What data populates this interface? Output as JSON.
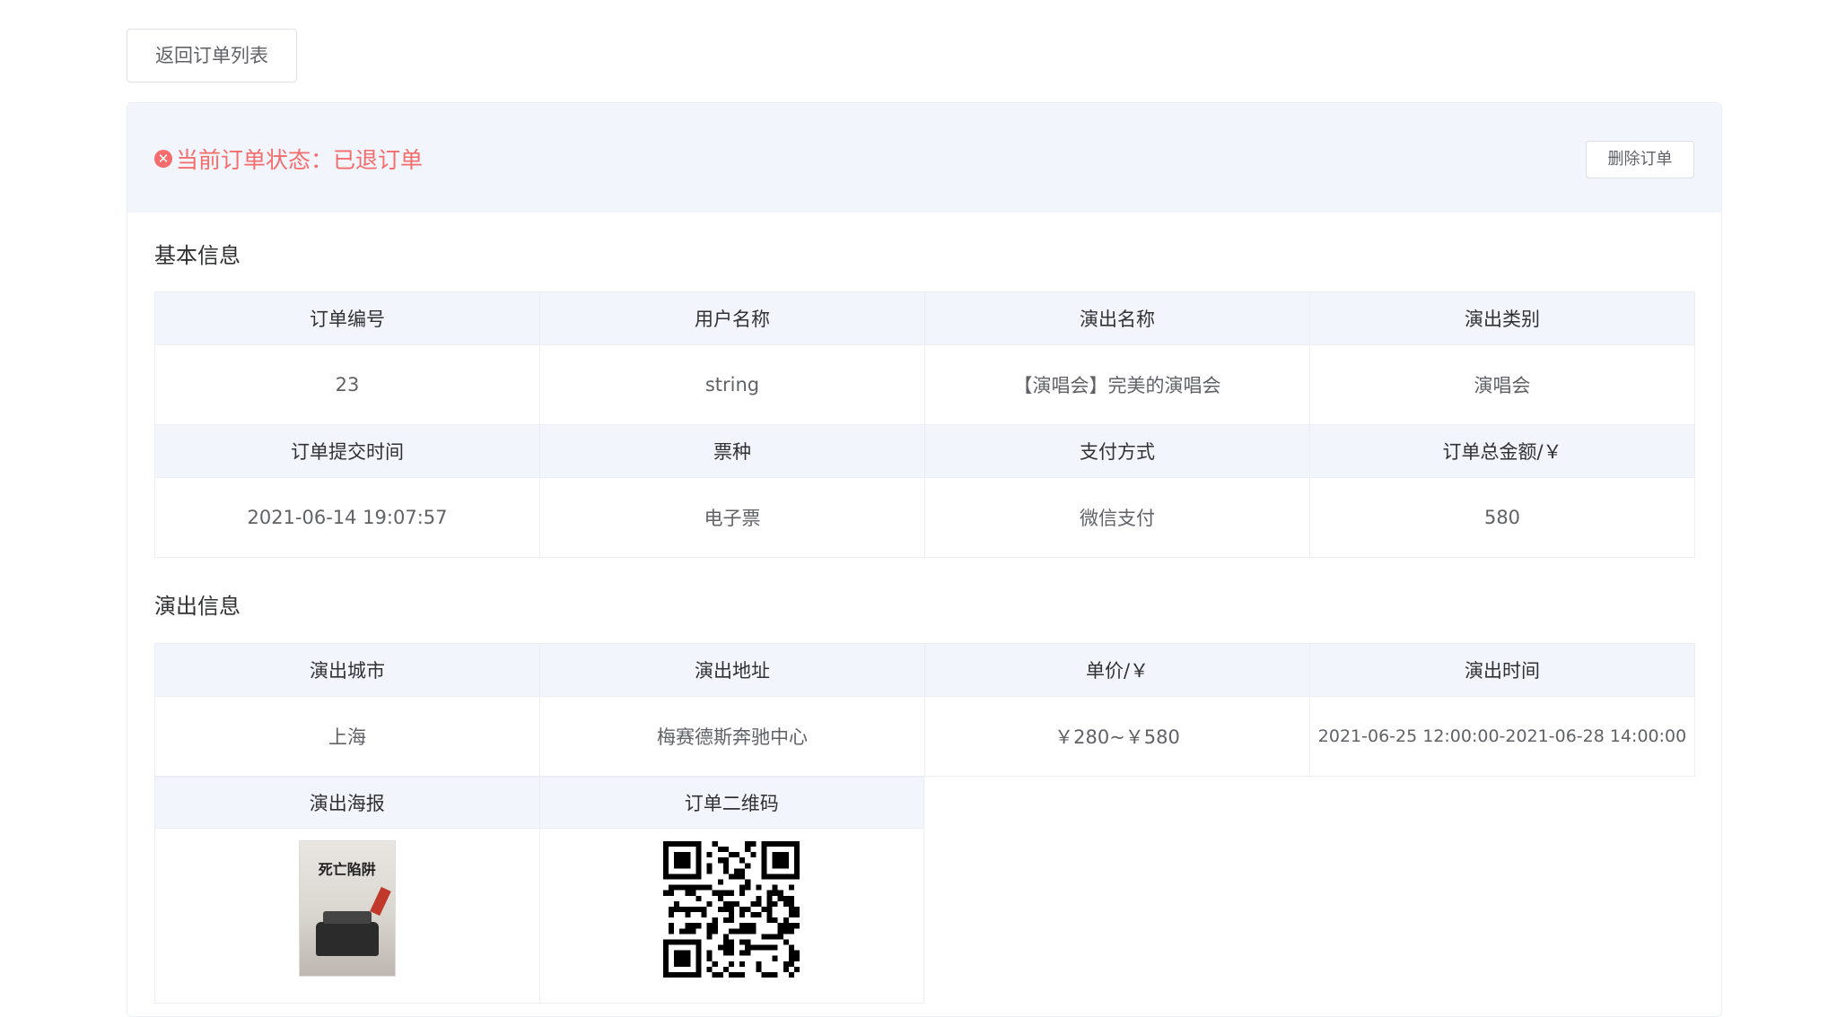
{
  "back_button": "返回订单列表",
  "status": {
    "icon": "x-circle-icon",
    "text": "当前订单状态：已退订单",
    "color": "#f56c6c"
  },
  "delete_button": "删除订单",
  "basic_info": {
    "title": "基本信息",
    "row1_headers": [
      "订单编号",
      "用户名称",
      "演出名称",
      "演出类别"
    ],
    "row1_values": [
      "23",
      "string",
      "【演唱会】完美的演唱会",
      "演唱会"
    ],
    "row2_headers": [
      "订单提交时间",
      "票种",
      "支付方式",
      "订单总金额/￥"
    ],
    "row2_values": [
      "2021-06-14 19:07:57",
      "电子票",
      "微信支付",
      "580"
    ]
  },
  "show_info": {
    "title": "演出信息",
    "headers": [
      "演出城市",
      "演出地址",
      "单价/￥",
      "演出时间"
    ],
    "values": [
      "上海",
      "梅赛德斯奔驰中心",
      "￥280~￥580",
      "2021-06-25 12:00:00-2021-06-28 14:00:00"
    ],
    "media_headers": [
      "演出海报",
      "订单二维码"
    ],
    "poster_title": "死亡陷阱"
  }
}
